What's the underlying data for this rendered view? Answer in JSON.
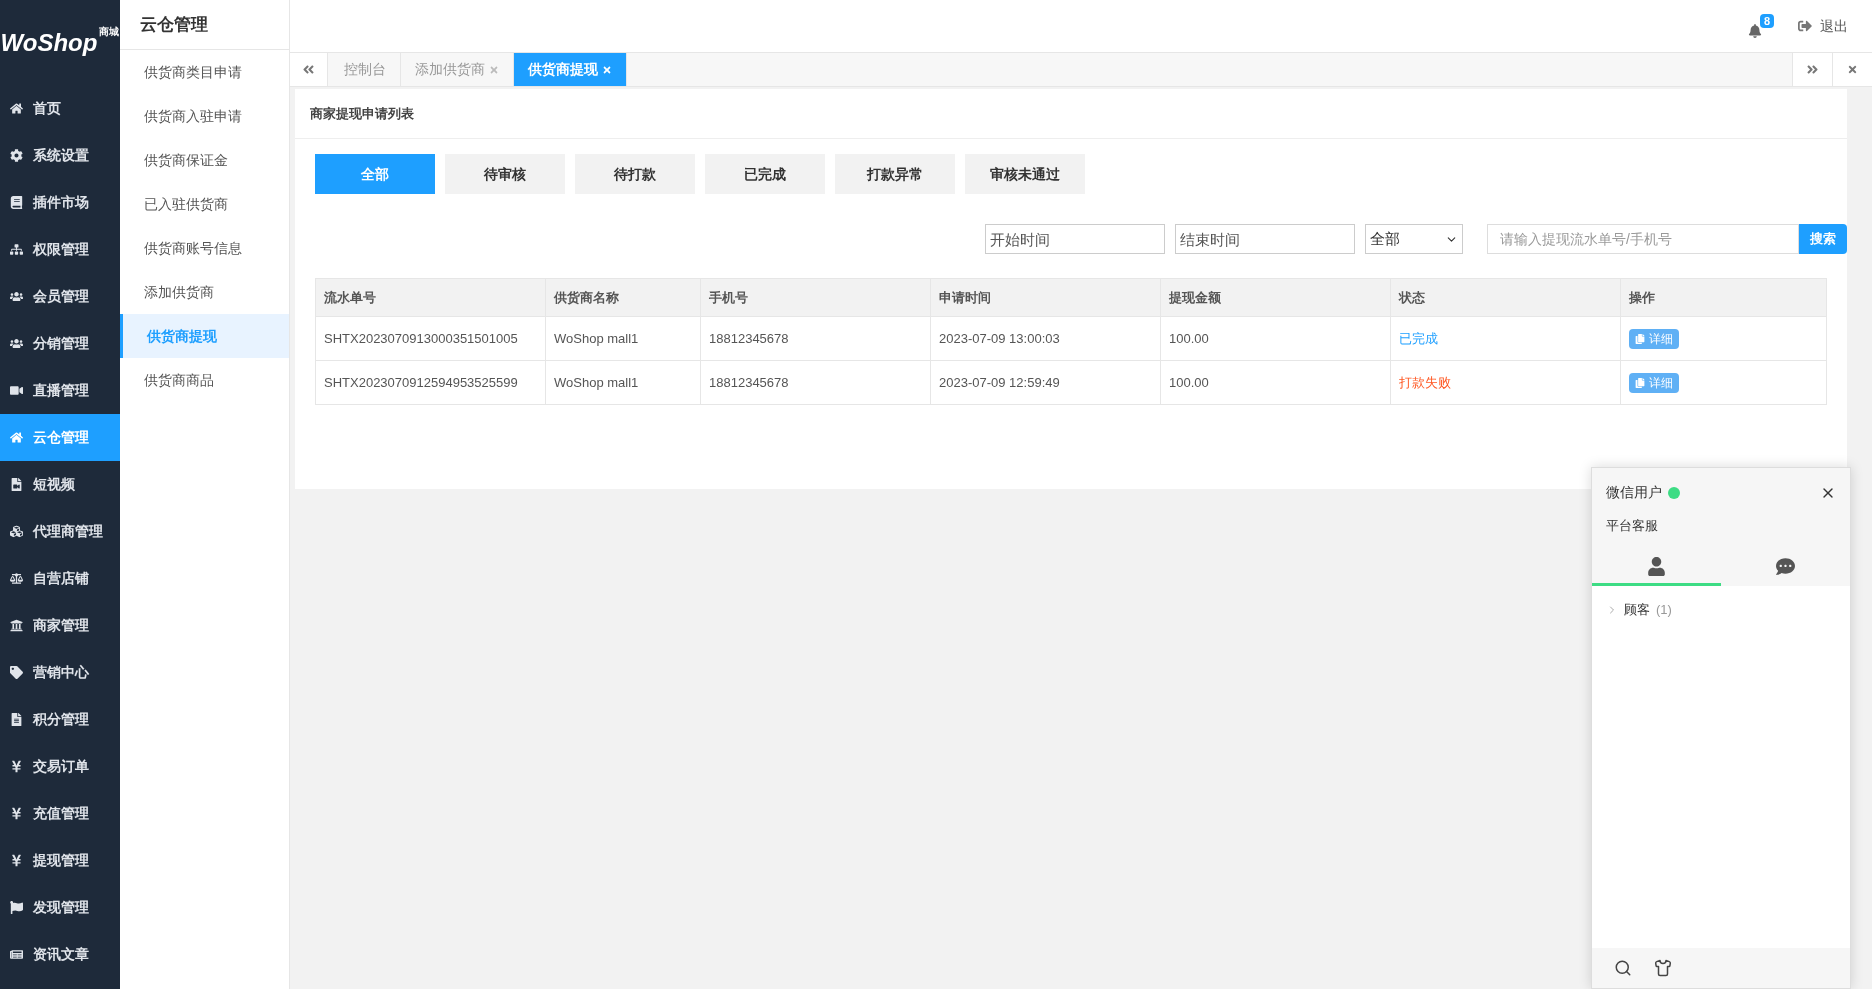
{
  "logo": {
    "name": "WoShop",
    "tag": "商城"
  },
  "sidebar": {
    "items": [
      {
        "label": "首页",
        "selected": false
      },
      {
        "label": "系统设置",
        "selected": false
      },
      {
        "label": "插件市场",
        "selected": false
      },
      {
        "label": "权限管理",
        "selected": false
      },
      {
        "label": "会员管理",
        "selected": false
      },
      {
        "label": "分销管理",
        "selected": false
      },
      {
        "label": "直播管理",
        "selected": false
      },
      {
        "label": "云仓管理",
        "selected": true
      },
      {
        "label": "短视频",
        "selected": false
      },
      {
        "label": "代理商管理",
        "selected": false
      },
      {
        "label": "自营店铺",
        "selected": false
      },
      {
        "label": "商家管理",
        "selected": false
      },
      {
        "label": "营销中心",
        "selected": false
      },
      {
        "label": "积分管理",
        "selected": false
      },
      {
        "label": "交易订单",
        "selected": false
      },
      {
        "label": "充值管理",
        "selected": false
      },
      {
        "label": "提现管理",
        "selected": false
      },
      {
        "label": "发现管理",
        "selected": false
      },
      {
        "label": "资讯文章",
        "selected": false
      }
    ]
  },
  "submenu": {
    "title": "云仓管理",
    "items": [
      {
        "label": "供货商类目申请",
        "selected": false
      },
      {
        "label": "供货商入驻申请",
        "selected": false
      },
      {
        "label": "供货商保证金",
        "selected": false
      },
      {
        "label": "已入驻供货商",
        "selected": false
      },
      {
        "label": "供货商账号信息",
        "selected": false
      },
      {
        "label": "添加供货商",
        "selected": false
      },
      {
        "label": "供货商提现",
        "selected": true
      },
      {
        "label": "供货商商品",
        "selected": false
      }
    ]
  },
  "header": {
    "notification_count": "8",
    "logout": "退出"
  },
  "tabs": [
    {
      "label": "控制台",
      "selected": false,
      "closable": false
    },
    {
      "label": "添加供货商",
      "selected": false,
      "closable": true
    },
    {
      "label": "供货商提现",
      "selected": true,
      "closable": true
    }
  ],
  "card": {
    "title": "商家提现申请列表",
    "status_filters": [
      {
        "label": "全部",
        "selected": true
      },
      {
        "label": "待审核",
        "selected": false
      },
      {
        "label": "待打款",
        "selected": false
      },
      {
        "label": "已完成",
        "selected": false
      },
      {
        "label": "打款异常",
        "selected": false
      },
      {
        "label": "审核未通过",
        "selected": false
      }
    ],
    "start_time": {
      "placeholder": "开始时间"
    },
    "end_time": {
      "placeholder": "结束时间"
    },
    "status_select": {
      "value": "全部"
    },
    "search": {
      "placeholder": "请输入提现流水单号/手机号",
      "button": "搜索"
    },
    "table": {
      "columns": [
        "流水单号",
        "供货商名称",
        "手机号",
        "申请时间",
        "提现金额",
        "状态",
        "操作"
      ],
      "rows": [
        {
          "serial": "SHTX2023070913000351501005",
          "supplier": "WoShop mall1",
          "phone": "18812345678",
          "time": "2023-07-09 13:00:03",
          "amount": "100.00",
          "status": "已完成",
          "kind": "completed",
          "action": "详细"
        },
        {
          "serial": "SHTX2023070912594953525599",
          "supplier": "WoShop mall1",
          "phone": "18812345678",
          "time": "2023-07-09 12:59:49",
          "amount": "100.00",
          "status": "打款失败",
          "kind": "failed",
          "action": "详细"
        }
      ]
    }
  },
  "chat": {
    "user": "微信用户",
    "online": true,
    "subtitle": "平台客服",
    "tabs": [
      {
        "kind": "contacts",
        "selected": true
      },
      {
        "kind": "messages",
        "selected": false
      }
    ],
    "groups": [
      {
        "label": "顾客",
        "count": "(1)",
        "expanded": false
      }
    ]
  }
}
